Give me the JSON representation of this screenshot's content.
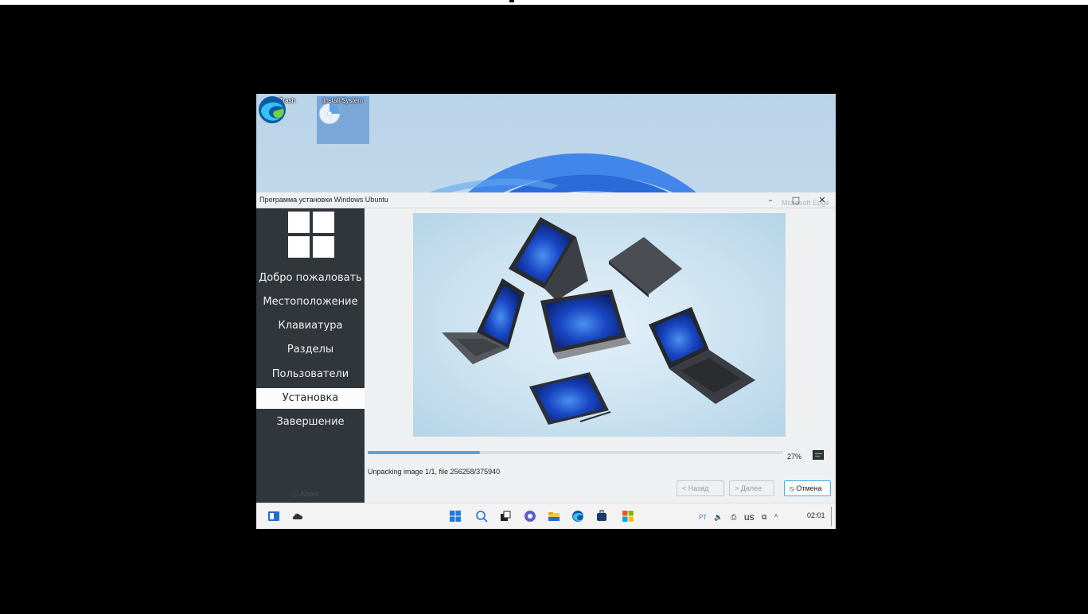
{
  "desktop": {
    "icons": [
      {
        "label": "Trash"
      },
      {
        "label": "Install System"
      }
    ],
    "edge_label": "Microsoft Edge"
  },
  "installer": {
    "title": "Программа установки Windows Ubuntu",
    "window_controls": {
      "minimize": "–",
      "maximize": "□",
      "close": "✕"
    },
    "steps": [
      {
        "label": "Добро пожаловать",
        "active": false
      },
      {
        "label": "Местоположение",
        "active": false
      },
      {
        "label": "Клавиатура",
        "active": false
      },
      {
        "label": "Разделы",
        "active": false
      },
      {
        "label": "Пользователи",
        "active": false
      },
      {
        "label": "Установка",
        "active": true
      },
      {
        "label": "Завершение",
        "active": false
      }
    ],
    "about_label": "ⓘ About",
    "progress": {
      "value": 0.27,
      "label": "27%"
    },
    "status": "Unpacking image 1/1, file 256258/375940",
    "buttons": {
      "back": "< Назад",
      "next": "> Далее",
      "cancel": "⦸ Отмена"
    },
    "accent_color": "#3daee9",
    "sidebar_color": "#31363b"
  },
  "taskbar": {
    "tray": {
      "language": "РТ",
      "volume_icon": "speaker-icon",
      "clipboard_icon": "clipboard-icon",
      "keyboard_layout": "us",
      "network_icon": "network-icon",
      "expand": "^"
    },
    "clock": "02:01"
  }
}
